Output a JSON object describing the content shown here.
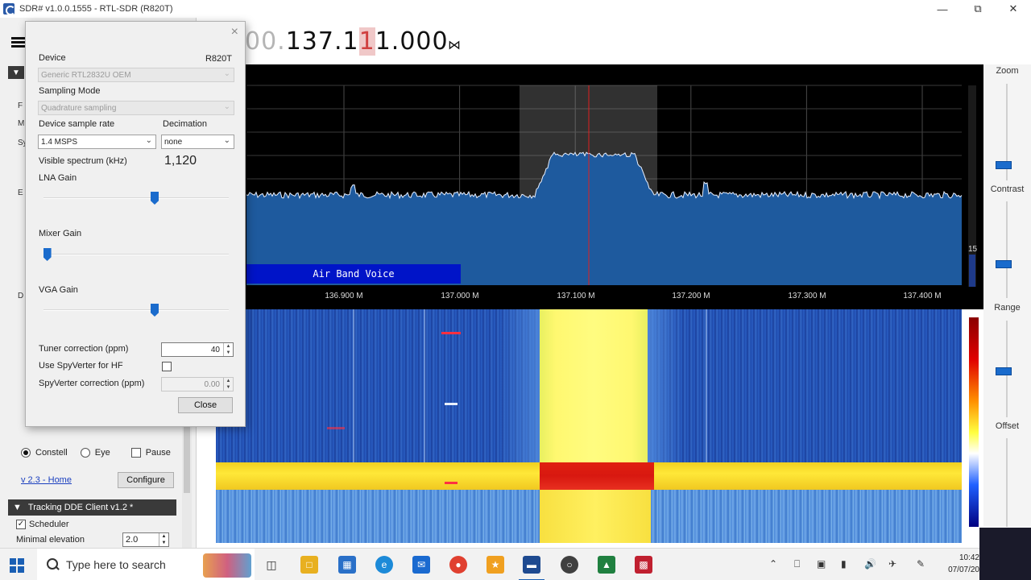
{
  "window": {
    "title": "SDR# v1.0.0.1555 - RTL-SDR (R820T)",
    "minimize": "—",
    "maximize": "⧉",
    "close": "✕"
  },
  "frequency": {
    "prefix": "00.",
    "main": "137.1",
    "cursor_digit": "1",
    "suffix": "1.000",
    "tune_icon": "⋈"
  },
  "left_panel": {
    "stubs": [
      "F",
      "M",
      "Sy",
      "E",
      "D"
    ],
    "constellation_label": "Constell",
    "eye_label": "Eye",
    "pause_label": "Pause",
    "version_link": "v 2.3 - Home",
    "configure_label": "Configure",
    "tracking_header": "Tracking DDE Client v1.2 *",
    "scheduler_label": "Scheduler",
    "minimal_elevation_label": "Minimal elevation",
    "minimal_elevation_value": "2.0",
    "check_mark": "✓"
  },
  "dialog": {
    "close_x": "×",
    "device_label": "Device",
    "device_value": "R820T",
    "device_combo": "Generic RTL2832U OEM",
    "sampling_mode_label": "Sampling Mode",
    "sampling_mode_combo": "Quadrature sampling",
    "sample_rate_label": "Device sample rate",
    "sample_rate_combo": "1.4 MSPS",
    "decimation_label": "Decimation",
    "decimation_combo": "none",
    "visible_spectrum_label": "Visible spectrum (kHz)",
    "visible_spectrum_value": "1,120",
    "lna_gain_label": "LNA Gain",
    "mixer_gain_label": "Mixer Gain",
    "vga_gain_label": "VGA Gain",
    "lna_gain_level": 0.6,
    "mixer_gain_level": 0.02,
    "vga_gain_level": 0.6,
    "tuner_correction_label": "Tuner correction (ppm)",
    "tuner_correction_value": "40",
    "spyverter_label": "Use SpyVerter for HF",
    "spyverter_correction_label": "SpyVerter correction (ppm)",
    "spyverter_correction_value": "0.00",
    "close_label": "Close",
    "combo_arrow": "⌄"
  },
  "spectrum": {
    "band_label": "Air Band Voice",
    "axis_labels": [
      "136.900 M",
      "137.000 M",
      "137.100 M",
      "137.200 M",
      "137.300 M",
      "137.400 M"
    ],
    "db_label": "15"
  },
  "right_bar": {
    "zoom_label": "Zoom",
    "contrast_label": "Contrast",
    "range_label": "Range",
    "offset_label": "Offset"
  },
  "taskbar": {
    "search_placeholder": "Type here to search",
    "time": "10:42",
    "date": "07/07/20"
  },
  "colors": {
    "accent": "#1a6bcc",
    "band_label_bg": "#0014c8",
    "spectrum_fill": "#1e5a9e"
  }
}
